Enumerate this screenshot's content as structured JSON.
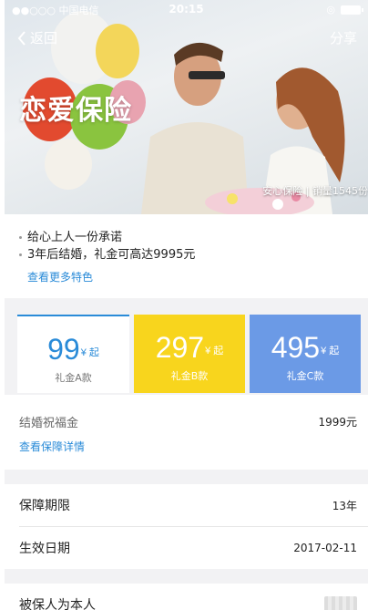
{
  "status_bar": {
    "carrier": "●●○○○ 中国电信",
    "wifi_icon": "wifi-icon",
    "time": "20:15",
    "battery_icon": "battery-icon"
  },
  "nav": {
    "back_label": "返回",
    "share_label": "分享"
  },
  "hero": {
    "title": "恋爱保险",
    "caption": "安心保险 | 销量1545份"
  },
  "features": {
    "items": [
      "给心上人一份承诺",
      "3年后结婚，礼金可高达9995元"
    ],
    "more_link": "查看更多特色"
  },
  "plans": [
    {
      "price": "99",
      "unit": "¥ 起",
      "name": "礼金A款",
      "selected": true
    },
    {
      "price": "297",
      "unit": "¥ 起",
      "name": "礼金B款",
      "selected": false
    },
    {
      "price": "495",
      "unit": "¥ 起",
      "name": "礼金C款",
      "selected": false
    }
  ],
  "coverage": {
    "blessing_label": "结婚祝福金",
    "blessing_value": "1999元",
    "detail_link": "查看保障详情",
    "period_label": "保障期限",
    "period_value": "13年",
    "effective_label": "生效日期",
    "effective_value": "2017-02-11",
    "insured_label": "被保人为本人"
  },
  "colors": {
    "accent_blue": "#2a8bd8",
    "plan_b_yellow": "#f8d51d",
    "plan_c_blue": "#6b9ae6",
    "background_gray": "#f2f2f4"
  }
}
